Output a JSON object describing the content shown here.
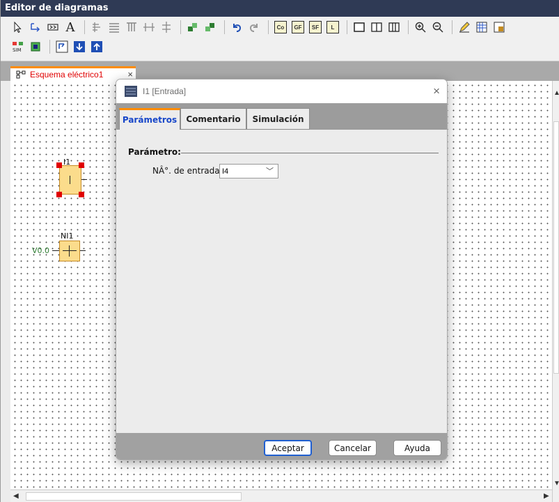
{
  "window": {
    "title": "Editor de diagramas"
  },
  "toolbar": {
    "row1": [
      "select-icon",
      "connect-icon",
      "block-icon",
      "text-icon",
      "align-icons",
      "undo-icon",
      "redo-icon"
    ],
    "special_buttons": [
      "Co",
      "GF",
      "SF",
      "L"
    ]
  },
  "document_tab": {
    "label": "Esquema eléctrico1",
    "close": "×"
  },
  "canvas": {
    "blocks": [
      {
        "name": "I1",
        "selected": true
      },
      {
        "name": "NI1",
        "input": "V0.0"
      }
    ]
  },
  "dialog": {
    "title": "I1 [Entrada]",
    "close": "×",
    "tabs": [
      "Parámetros",
      "Comentario",
      "Simulación"
    ],
    "active_tab": "Parámetros",
    "group_title": "Parámetro:",
    "field_label": "NÂ°. de entrada:",
    "field_value": "I4",
    "buttons": {
      "ok": "Aceptar",
      "cancel": "Cancelar",
      "help": "Ayuda"
    }
  },
  "colors": {
    "titlebar": "#2f3a55",
    "accent": "#ff8c00",
    "active_tab_text": "#1847c9",
    "block_fill": "#fbdc8c",
    "handle": "#e00000"
  }
}
